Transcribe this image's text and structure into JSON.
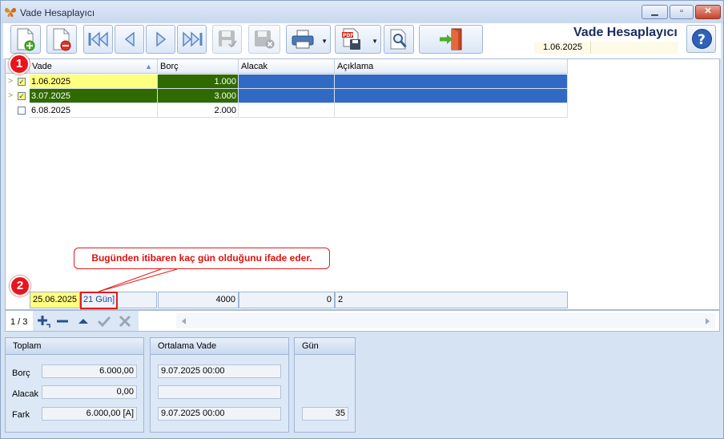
{
  "window": {
    "title": "Vade Hesaplayıcı",
    "minimize": "▁",
    "maximize": "▫",
    "close": "✕"
  },
  "header": {
    "title": "Vade Hesaplayıcı",
    "date": "1.06.2025"
  },
  "grid": {
    "columns": [
      "Vade",
      "Borç",
      "Alacak",
      "Açıklama"
    ],
    "rows": [
      {
        "vade": "1.06.2025",
        "borc": "1.000",
        "alacak": "",
        "aciklama": "",
        "checked": true
      },
      {
        "vade": "3.07.2025",
        "borc": "3.000",
        "alacak": "",
        "aciklama": "",
        "checked": true
      },
      {
        "vade": "6.08.2025",
        "borc": "2.000",
        "alacak": "",
        "aciklama": "",
        "checked": false
      }
    ],
    "footer": {
      "vade": "25.06.2025",
      "gun": "21 Gün]",
      "borc": "4000",
      "alacak": "0",
      "aciklama": "2"
    }
  },
  "annotations": {
    "badge1": "1",
    "badge2": "2",
    "callout": "Bugünden itibaren kaç gün olduğunu ifade eder."
  },
  "navigator": {
    "pager": "1 / 3"
  },
  "summary": {
    "toplam": {
      "title": "Toplam",
      "borc_label": "Borç",
      "borc": "6.000,00",
      "alacak_label": "Alacak",
      "alacak": "0,00",
      "fark_label": "Fark",
      "fark": "6.000,00 [A]"
    },
    "ortalama": {
      "title": "Ortalama Vade",
      "borc": "9.07.2025 00:00",
      "alacak": "",
      "fark": "9.07.2025 00:00"
    },
    "gun": {
      "title": "Gün",
      "fark": "35"
    }
  },
  "colors": {
    "selected_yellow": "#ffff80",
    "selected_green": "#2f6a00",
    "highlight_blue": "#316ac5",
    "accent_red": "#e21b1b"
  }
}
